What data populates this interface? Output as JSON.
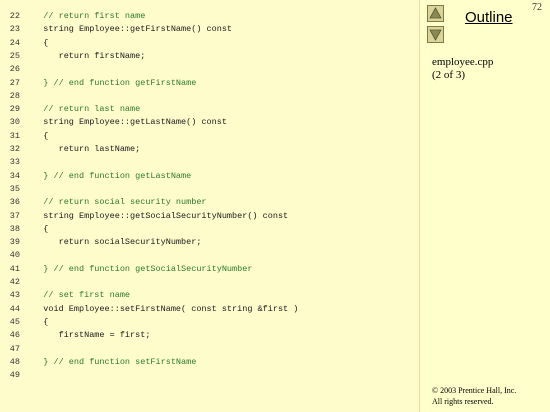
{
  "code_lines": [
    {
      "num": "22",
      "text": "   // return first name",
      "kind": "comment"
    },
    {
      "num": "23",
      "text": "   string Employee::getFirstName() const",
      "kind": "code"
    },
    {
      "num": "24",
      "text": "   {",
      "kind": "code"
    },
    {
      "num": "25",
      "text": "      return firstName;",
      "kind": "code"
    },
    {
      "num": "26",
      "text": "",
      "kind": "code"
    },
    {
      "num": "27",
      "text": "   } // end function getFirstName",
      "kind": "comment"
    },
    {
      "num": "28",
      "text": "",
      "kind": "code"
    },
    {
      "num": "29",
      "text": "   // return last name",
      "kind": "comment"
    },
    {
      "num": "30",
      "text": "   string Employee::getLastName() const",
      "kind": "code"
    },
    {
      "num": "31",
      "text": "   {",
      "kind": "code"
    },
    {
      "num": "32",
      "text": "      return lastName;",
      "kind": "code"
    },
    {
      "num": "33",
      "text": "",
      "kind": "code"
    },
    {
      "num": "34",
      "text": "   } // end function getLastName",
      "kind": "comment"
    },
    {
      "num": "35",
      "text": "",
      "kind": "code"
    },
    {
      "num": "36",
      "text": "   // return social security number",
      "kind": "comment"
    },
    {
      "num": "37",
      "text": "   string Employee::getSocialSecurityNumber() const",
      "kind": "code"
    },
    {
      "num": "38",
      "text": "   {",
      "kind": "code"
    },
    {
      "num": "39",
      "text": "      return socialSecurityNumber;",
      "kind": "code"
    },
    {
      "num": "40",
      "text": "",
      "kind": "code"
    },
    {
      "num": "41",
      "text": "   } // end function getSocialSecurityNumber",
      "kind": "comment"
    },
    {
      "num": "42",
      "text": "",
      "kind": "code"
    },
    {
      "num": "43",
      "text": "   // set first name",
      "kind": "comment"
    },
    {
      "num": "44",
      "text": "   void Employee::setFirstName( const string &first )",
      "kind": "code"
    },
    {
      "num": "45",
      "text": "   {",
      "kind": "code"
    },
    {
      "num": "46",
      "text": "      firstName = first;",
      "kind": "code"
    },
    {
      "num": "47",
      "text": "",
      "kind": "code"
    },
    {
      "num": "48",
      "text": "   } // end function setFirstName",
      "kind": "comment"
    },
    {
      "num": "49",
      "text": "",
      "kind": "code"
    }
  ],
  "sidebar": {
    "page_number": "72",
    "outline_label": "Outline",
    "file_name": "employee.cpp",
    "file_part": "(2 of 3)",
    "copyright": "© 2003 Prentice Hall, Inc.",
    "rights": "All rights reserved."
  },
  "nav": {
    "prev_icon": "triangle-up-icon",
    "next_icon": "triangle-down-icon"
  },
  "colors": {
    "code_bg": "#fffccc",
    "comment": "#2b7a2b",
    "button_bg": "#d8d49c"
  }
}
